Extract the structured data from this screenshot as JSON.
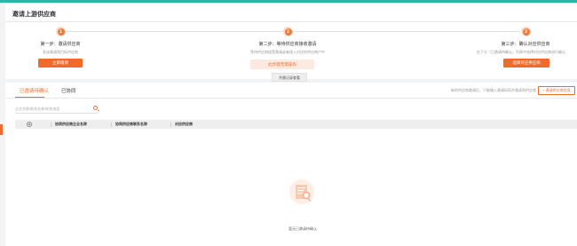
{
  "page": {
    "title": "邀请上游供应商"
  },
  "steps": [
    {
      "number": "1",
      "title": "第一步：邀请供应商",
      "description": "发送邀请到目标供应商",
      "button": "立即邀请"
    },
    {
      "number": "2",
      "title": "第二步：等待供应商接收邀请",
      "description": "等待供应商接受邀请或者接入对应的供应商户中",
      "button": "此步骤无需操作",
      "secondary_button": "共邀记录查看"
    },
    {
      "number": "3",
      "title": "第三步：确认对应供应商",
      "description": "在下方『已邀请待确认』列表中选择对应供应商进行确认",
      "button": "选择对应供应商"
    }
  ],
  "tabs": [
    {
      "label": "已邀请待确认",
      "active": true
    },
    {
      "label": "已协同",
      "active": false
    }
  ],
  "toolbar": {
    "hint": "新的供应商邀请后，只能输入邀请码同步邀请到供应商",
    "invite_button": "+ 邀请供应商信息"
  },
  "search": {
    "placeholder": "企业名称/联系名称/联系电话"
  },
  "table": {
    "columns": [
      "协同供应商企业名称",
      "协同供应商联系名称",
      "对应供应商"
    ]
  },
  "empty_state": {
    "text": "暂无已邀请待确认"
  },
  "colors": {
    "accent": "#f06a2b",
    "top_bar": "#2ab7a9"
  }
}
